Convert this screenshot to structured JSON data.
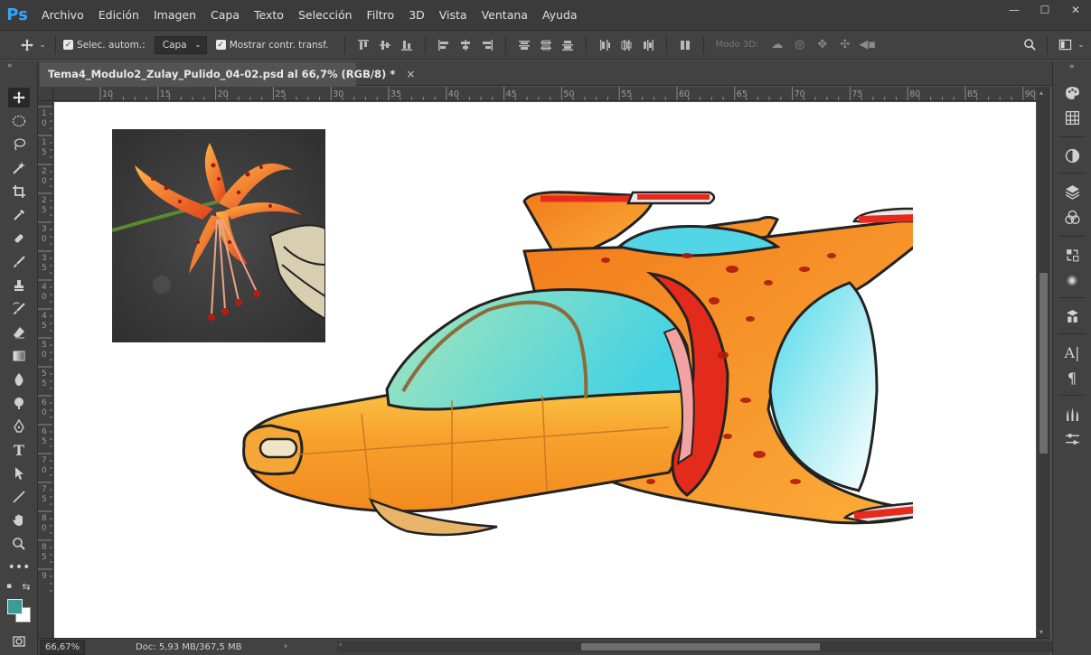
{
  "app": {
    "logo": "Ps",
    "menu": [
      "Archivo",
      "Edición",
      "Imagen",
      "Capa",
      "Texto",
      "Selección",
      "Filtro",
      "3D",
      "Vista",
      "Ventana",
      "Ayuda"
    ],
    "window_controls": {
      "minimize": "—",
      "restore": "☐",
      "close": "✕"
    }
  },
  "options": {
    "auto_select_label": "Selec. autom.:",
    "auto_select_target": "Capa",
    "show_transform_label": "Mostrar contr. transf.",
    "mode_3d_label": "Modo 3D:"
  },
  "document": {
    "tab_title": "Tema4_Modulo2_Zulay_Pulido_04-02.psd al 66,7% (RGB/8) *",
    "tab_close": "×"
  },
  "rulers": {
    "top": [
      "10",
      "15",
      "20",
      "25",
      "30",
      "35",
      "40",
      "45",
      "50",
      "55",
      "60",
      "65",
      "70",
      "75",
      "80",
      "85",
      "90"
    ],
    "left": [
      "1",
      "1",
      "2",
      "2",
      "3",
      "3",
      "4",
      "4",
      "5",
      "5",
      "6",
      "6",
      "7",
      "7",
      "8",
      "8",
      "9"
    ],
    "left_sub": [
      "0",
      "5",
      "0",
      "5",
      "0",
      "5",
      "0",
      "5",
      "0",
      "5",
      "0",
      "5",
      "0",
      "5",
      "0",
      "5",
      ""
    ]
  },
  "status": {
    "zoom": "66,67%",
    "doc_info": "Doc: 5,93 MB/367,5 MB"
  },
  "colors": {
    "foreground": "#3d9b96",
    "background": "#ffffff",
    "ps_blue": "#31a8ff"
  }
}
